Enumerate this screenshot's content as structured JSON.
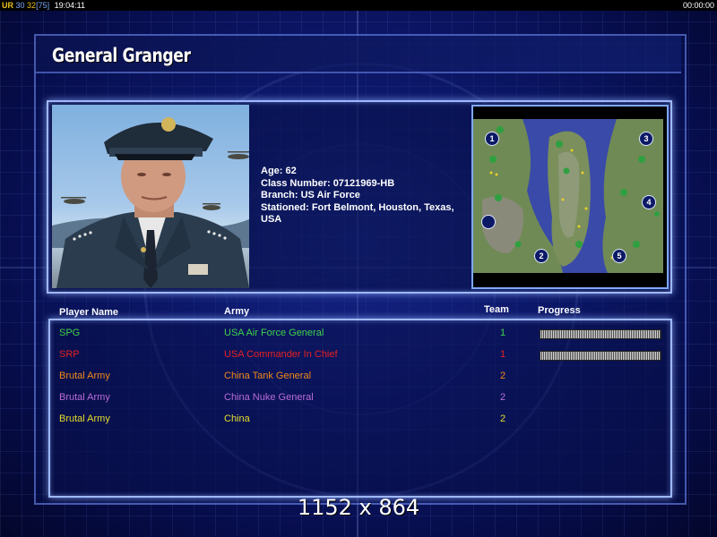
{
  "top_bar": {
    "code": "UR",
    "val_a": "30",
    "val_b": "32",
    "val_c": "[75]",
    "clock": "19:04:11",
    "timer": "00:00:00"
  },
  "general": {
    "name": "General Granger",
    "age": "Age: 62",
    "class_number": "Class Number: 07121969-HB",
    "branch": "Branch: US Air Force",
    "stationed": "Stationed: Fort Belmont, Houston, Texas, USA"
  },
  "map": {
    "slots": [
      "1",
      "2",
      "3",
      "4",
      "5"
    ]
  },
  "player_table": {
    "headers": {
      "name": "Player Name",
      "army": "Army",
      "team": "Team",
      "progress": "Progress"
    },
    "rows": [
      {
        "name": "SPG",
        "army": "USA Air Force General",
        "team": "1",
        "color": "#3fd24a",
        "progress": 1.0
      },
      {
        "name": "SRP",
        "army": "USA Commander In Chief",
        "team": "1",
        "color": "#e82020",
        "progress": 1.0
      },
      {
        "name": "Brutal Army",
        "army": "China Tank General",
        "team": "2",
        "color": "#f08a18",
        "progress": null
      },
      {
        "name": "Brutal Army",
        "army": "China Nuke General",
        "team": "2",
        "color": "#b86cd8",
        "progress": null
      },
      {
        "name": "Brutal Army",
        "army": "China",
        "team": "2",
        "color": "#e6dc2a",
        "progress": null
      }
    ]
  },
  "resolution": "1152 x 864"
}
